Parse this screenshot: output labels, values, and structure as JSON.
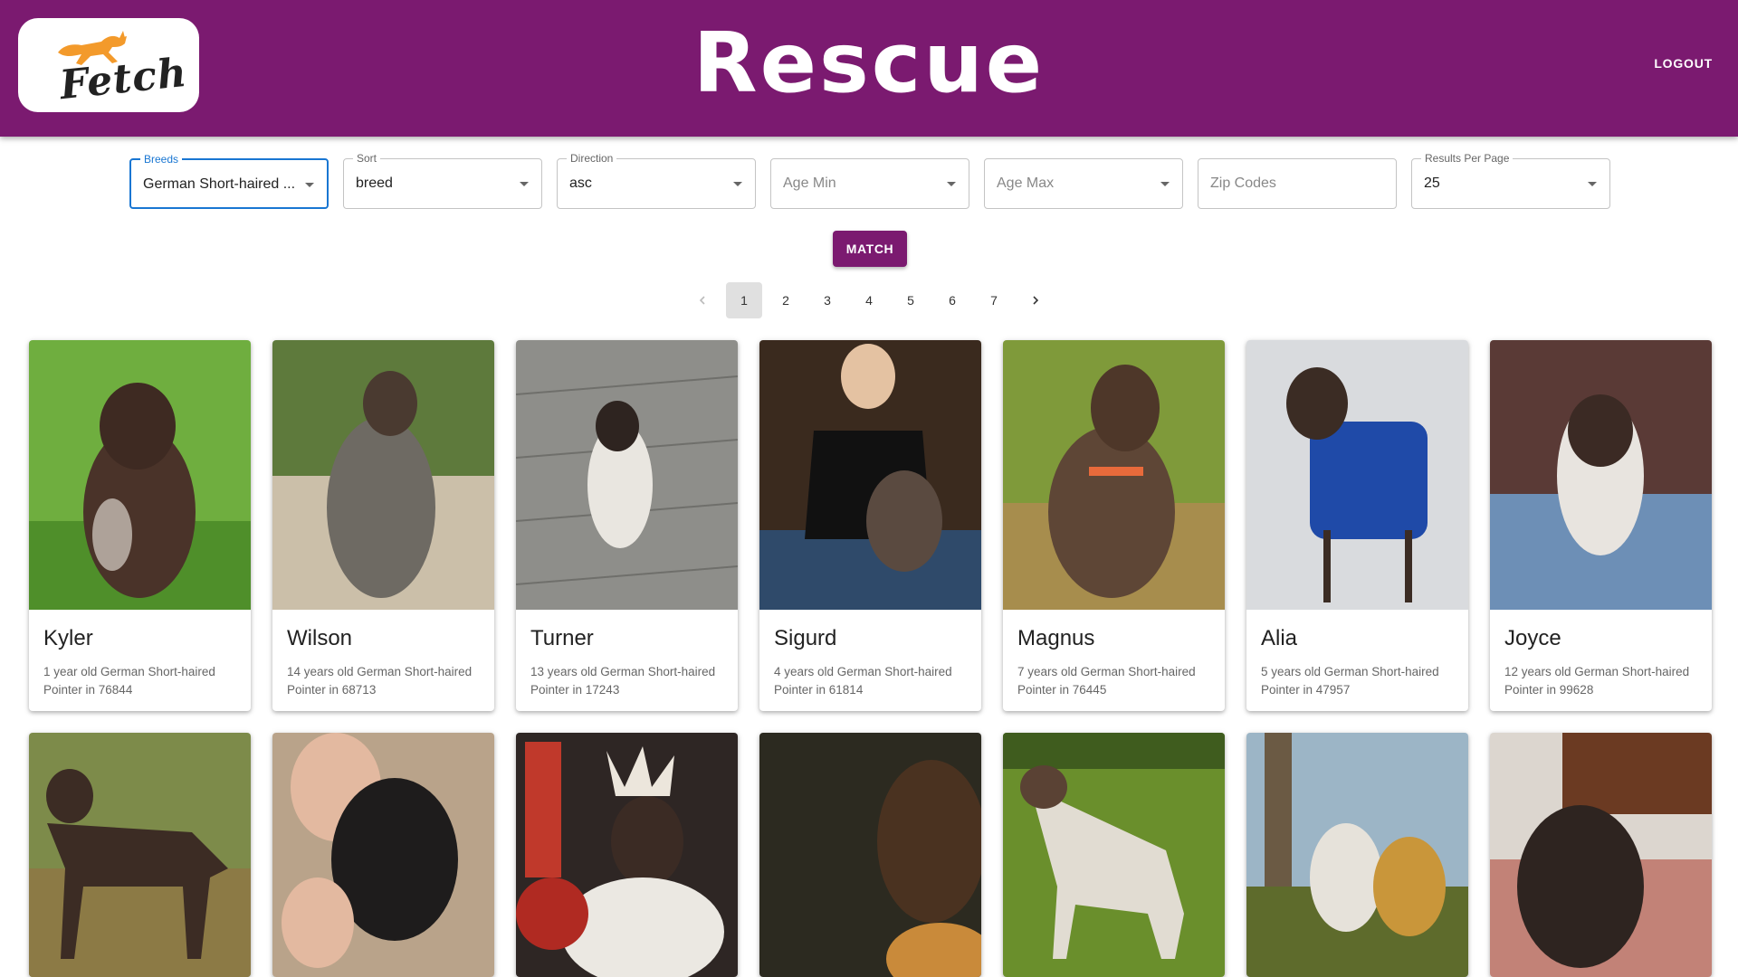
{
  "header": {
    "logo_text": "Fetch",
    "title": "Rescue",
    "logout_label": "LOGOUT"
  },
  "filters": {
    "breeds": {
      "label": "Breeds",
      "value": "German Short-haired ..."
    },
    "sort": {
      "label": "Sort",
      "value": "breed"
    },
    "direction": {
      "label": "Direction",
      "value": "asc"
    },
    "age_min": {
      "placeholder": "Age Min"
    },
    "age_max": {
      "placeholder": "Age Max"
    },
    "zip_codes": {
      "placeholder": "Zip Codes"
    },
    "results_per_page": {
      "label": "Results Per Page",
      "value": "25"
    }
  },
  "match_label": "MATCH",
  "pagination": {
    "prev_icon": "chevron-left-icon",
    "next_icon": "chevron-right-icon",
    "pages": [
      "1",
      "2",
      "3",
      "4",
      "5",
      "6",
      "7"
    ],
    "current": "1"
  },
  "dogs": [
    {
      "name": "Kyler",
      "desc": "1 year old German Short-haired Pointer in 76844"
    },
    {
      "name": "Wilson",
      "desc": "14 years old German Short-haired Pointer in 68713"
    },
    {
      "name": "Turner",
      "desc": "13 years old German Short-haired Pointer in 17243"
    },
    {
      "name": "Sigurd",
      "desc": "4 years old German Short-haired Pointer in 61814"
    },
    {
      "name": "Magnus",
      "desc": "7 years old German Short-haired Pointer in 76445"
    },
    {
      "name": "Alia",
      "desc": "5 years old German Short-haired Pointer in 47957"
    },
    {
      "name": "Joyce",
      "desc": "12 years old German Short-haired Pointer in 99628"
    }
  ],
  "colors": {
    "brand": "#7b1a70",
    "focus": "#1976d2"
  }
}
